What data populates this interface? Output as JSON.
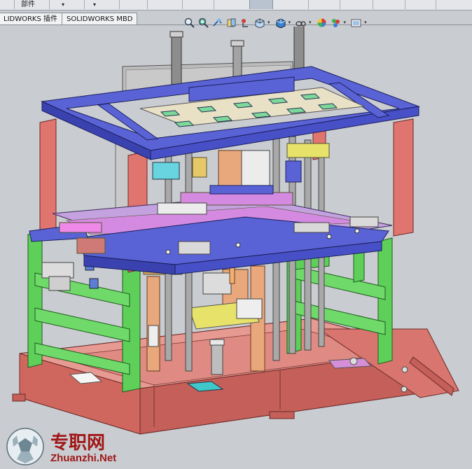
{
  "menu": {
    "part_label": "部件",
    "dropdown_glyph": "▾"
  },
  "command_tabs": [
    {
      "label": "LIDWORKS 插件"
    },
    {
      "label": "SOLIDWORKS MBD"
    }
  ],
  "heads_up_toolbar": [
    {
      "name": "zoom-to-fit-icon"
    },
    {
      "name": "zoom-to-area-icon"
    },
    {
      "name": "previous-view-icon"
    },
    {
      "name": "section-view-icon"
    },
    {
      "name": "dynamic-annotation-icon"
    },
    {
      "name": "view-orientation-icon"
    },
    {
      "name": "display-style-icon"
    },
    {
      "name": "hide-show-items-icon"
    },
    {
      "name": "edit-appearance-icon"
    },
    {
      "name": "apply-scene-icon"
    },
    {
      "name": "view-settings-icon"
    }
  ],
  "watermark": {
    "chinese": "专职网",
    "latin": "Zhuanzhi.Net"
  },
  "colors": {
    "frame_blue": "#5a63d6",
    "frame_red": "#e0746f",
    "frame_green": "#5ed05a",
    "base_red": "#d9756f",
    "plate_cream": "#e9e1c6",
    "viewport_bg": "#c9ccd0"
  }
}
